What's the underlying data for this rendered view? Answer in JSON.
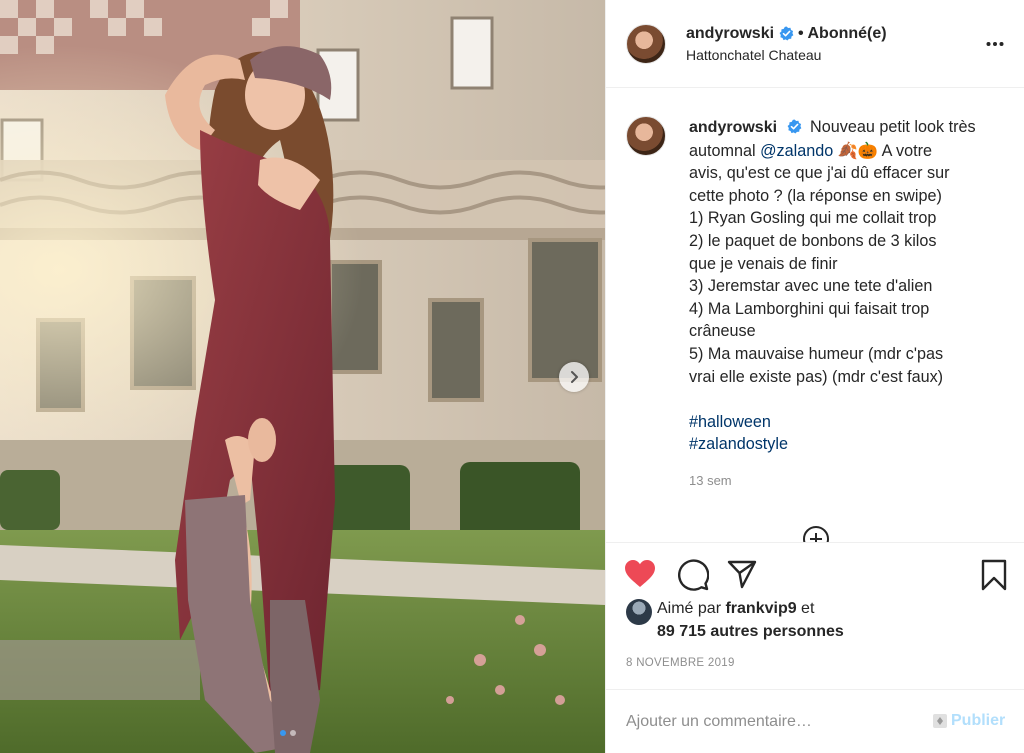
{
  "post": {
    "media": {
      "alt_icon": "photo",
      "carousel_total": 2,
      "carousel_active": 1,
      "next_icon": "chevron-right-icon"
    },
    "header": {
      "username": "andyrowski",
      "verified": true,
      "follow_state": "• Abonné(e)",
      "location": "Hattonchatel Chateau",
      "more_icon": "more-horizontal-icon"
    },
    "caption": {
      "username": "andyrowski",
      "lines": [
        "Nouveau petit look très",
        "automnal ",
        "@zalando",
        " 🍂🎃 A votre",
        "avis, qu'est ce que j'ai dû effacer sur",
        "cette photo ? (la réponse en swipe)",
        "1) Ryan Gosling qui me collait trop",
        "2) le paquet de bonbons de 3 kilos",
        "que je venais de finir",
        "3) Jeremstar avec une tete d'alien",
        "4) Ma Lamborghini qui faisait trop",
        "crâneuse",
        "5) Ma mauvaise humeur (mdr c'pas",
        "vrai elle existe pas) (mdr c'est faux)"
      ],
      "hashtags": [
        "#halloween",
        "#zalandostyle"
      ],
      "time_ago": "13 sem"
    },
    "actions": {
      "like_icon": "heart-filled-icon",
      "comment_icon": "comment-icon",
      "share_icon": "send-icon",
      "save_icon": "bookmark-icon",
      "like_color": "#ed4956"
    },
    "likes": {
      "prefix": "Aimé par ",
      "liker": "frankvip9",
      "conj": " et",
      "others": "89 715 autres personnes"
    },
    "date": "8 NOVEMBRE 2019",
    "comment": {
      "placeholder": "Ajouter un commentaire…",
      "publish_label": "Publier"
    }
  },
  "colors": {
    "text": "#262626",
    "muted": "#8e8e8e",
    "link": "#003569",
    "verified": "#3897f0",
    "publish_disabled": "#b2dffc"
  }
}
